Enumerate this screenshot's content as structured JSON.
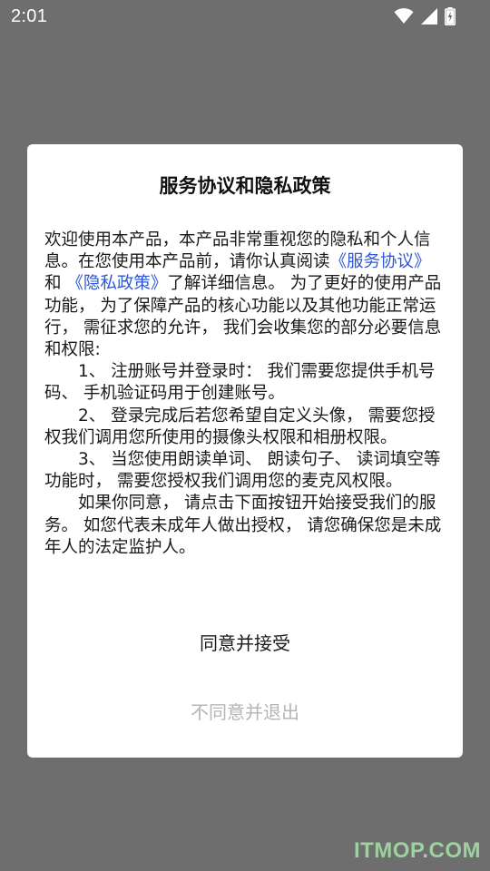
{
  "status_bar": {
    "time": "2:01",
    "icons": [
      "wifi-icon",
      "cellular-signal-icon",
      "battery-charging-icon"
    ],
    "color": "#ffffff"
  },
  "dialog": {
    "title": "服务协议和隐私政策",
    "intro_part1": "欢迎使用本产品，本产品非常重视您的隐私和个人信息。在您使用本产品前，请你认真阅读",
    "link_service": "《服务协议》",
    "intro_and": " 和 ",
    "link_privacy": "《隐私政策》",
    "intro_part2": "了解详细信息。 为了更好的使用产品功能， 为了保障产品的核心功能以及其他功能正常运行， 需征求您的允许， 我们会收集您的部分必要信息和权限:",
    "item_1": "1、 注册账号并登录时： 我们需要您提供手机号码、 手机验证码用于创建账号。",
    "item_2": "2、 登录完成后若您希望自定义头像， 需要您授权我们调用您所使用的摄像头权限和相册权限。",
    "item_3": "3、 当您使用朗读单词、 朗读句子、 读词填空等功能时， 需要您授权我们调用您的麦克风权限。",
    "closing": "如果你同意， 请点击下面按钮开始接受我们的服务。 如您代表未成年人做出授权， 请您确保您是未成年人的法定监护人。",
    "agree_label": "同意并接受",
    "disagree_label": "不同意并退出",
    "link_color": "#2f57d6",
    "disabled_text_color": "#b5b5b5"
  },
  "watermark": {
    "text": "ITMOP.COM",
    "color": "#9fd09f"
  },
  "background_color": "#6e6e6e"
}
